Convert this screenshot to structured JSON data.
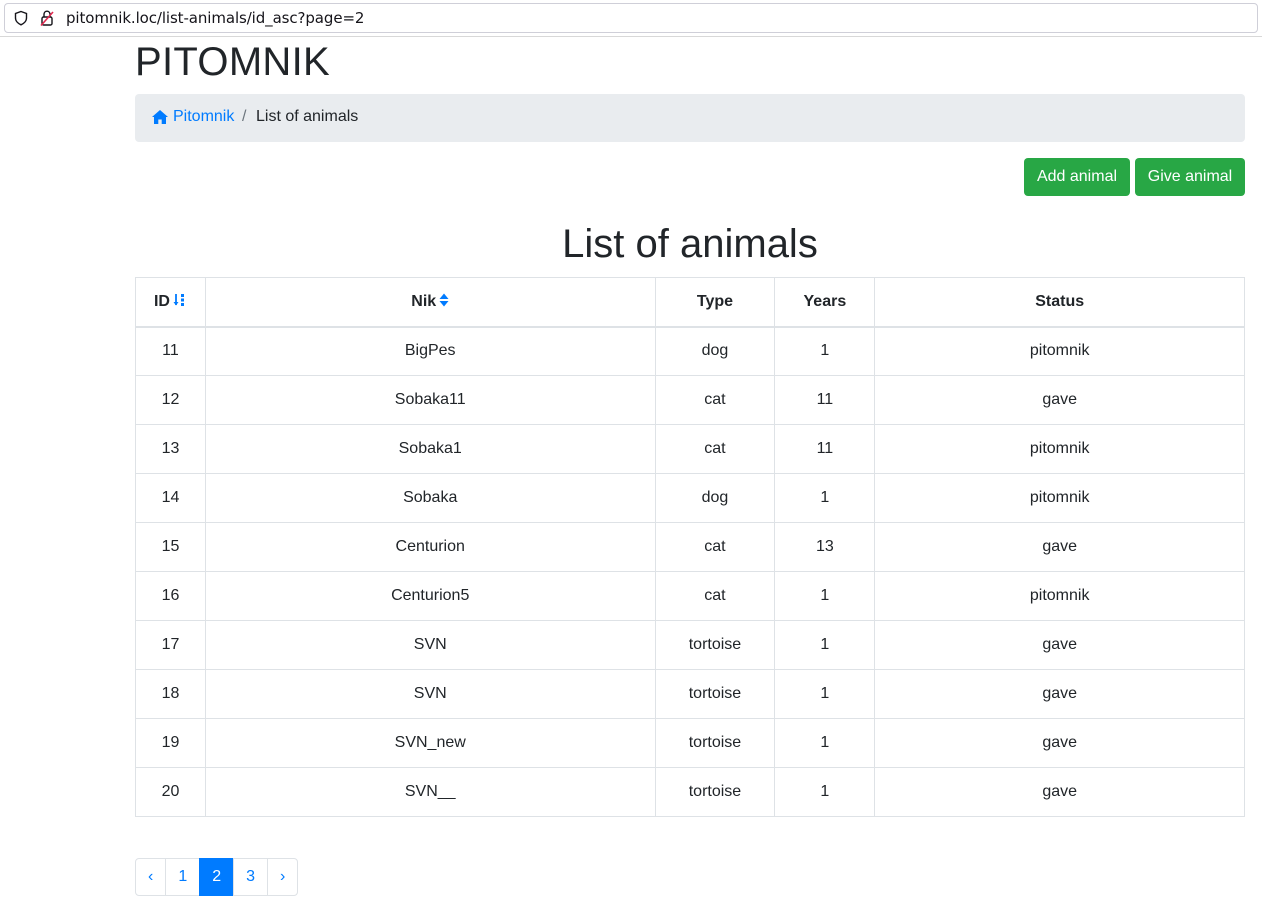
{
  "browser": {
    "url": "pitomnik.loc/list-animals/id_asc?page=2"
  },
  "site": {
    "brand": "PITOMNIK"
  },
  "breadcrumb": {
    "home": "Pitomnik",
    "separator": "/",
    "current": "List of animals"
  },
  "actions": {
    "add_label": "Add animal",
    "give_label": "Give animal"
  },
  "heading": "List of animals",
  "table": {
    "columns": [
      "ID",
      "Nik",
      "Type",
      "Years",
      "Status"
    ],
    "rows": [
      {
        "id": "11",
        "nik": "BigPes",
        "type": "dog",
        "years": "1",
        "status": "pitomnik"
      },
      {
        "id": "12",
        "nik": "Sobaka11",
        "type": "cat",
        "years": "11",
        "status": "gave"
      },
      {
        "id": "13",
        "nik": "Sobaka1",
        "type": "cat",
        "years": "11",
        "status": "pitomnik"
      },
      {
        "id": "14",
        "nik": "Sobaka",
        "type": "dog",
        "years": "1",
        "status": "pitomnik"
      },
      {
        "id": "15",
        "nik": "Centurion",
        "type": "cat",
        "years": "13",
        "status": "gave"
      },
      {
        "id": "16",
        "nik": "Centurion5",
        "type": "cat",
        "years": "1",
        "status": "pitomnik"
      },
      {
        "id": "17",
        "nik": "SVN",
        "type": "tortoise",
        "years": "1",
        "status": "gave"
      },
      {
        "id": "18",
        "nik": "SVN",
        "type": "tortoise",
        "years": "1",
        "status": "gave"
      },
      {
        "id": "19",
        "nik": "SVN_new",
        "type": "tortoise",
        "years": "1",
        "status": "gave"
      },
      {
        "id": "20",
        "nik": "SVN__",
        "type": "tortoise",
        "years": "1",
        "status": "gave"
      }
    ]
  },
  "pagination": {
    "prev": "‹",
    "pages": [
      "1",
      "2",
      "3"
    ],
    "current": "2",
    "next": "›"
  },
  "colors": {
    "primary": "#007bff",
    "success": "#28a745",
    "status_pitomnik": "#8b0000",
    "status_gave": "#008000"
  }
}
